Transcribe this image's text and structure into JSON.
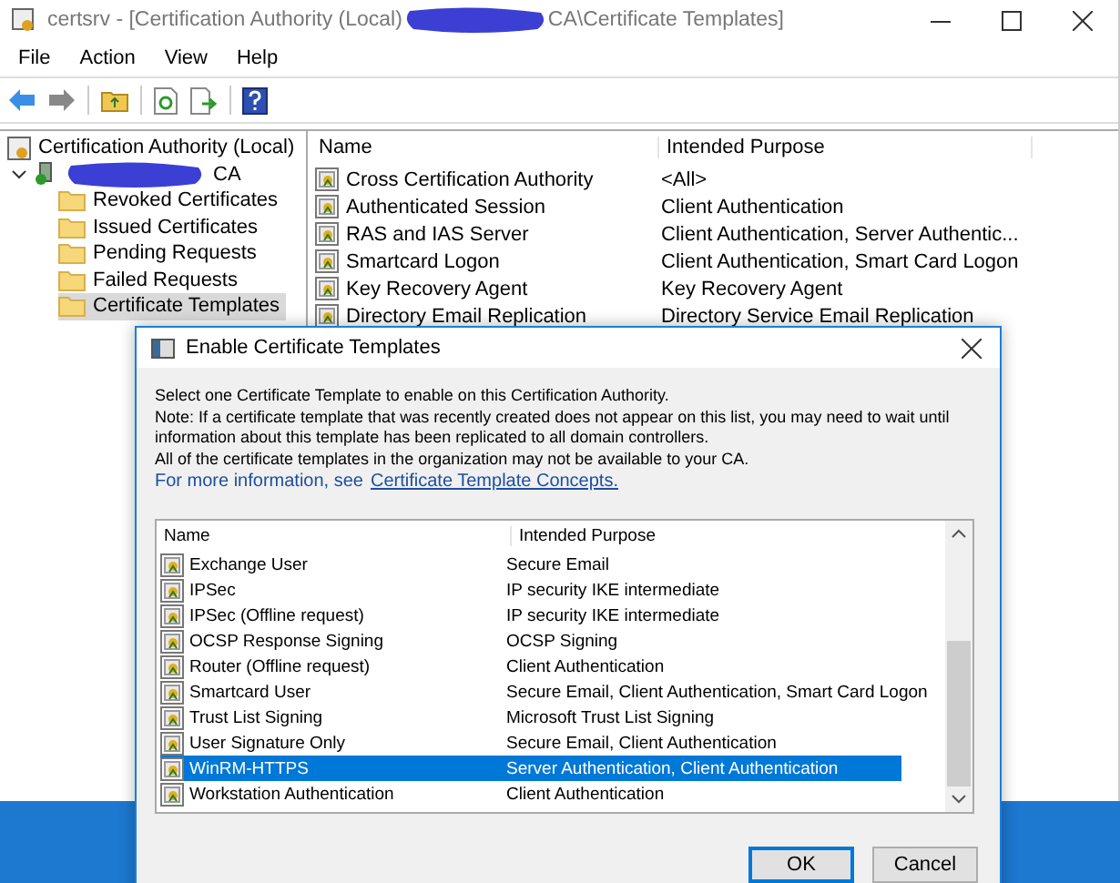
{
  "window": {
    "title_start": "certsrv - [Certification Authority (Local)",
    "title_end": "CA\\Certificate Templates]"
  },
  "menu": [
    "File",
    "Action",
    "View",
    "Help"
  ],
  "tree": {
    "label": "Certification Authority (Local)",
    "children": [
      {
        "label": "CA",
        "expanded": true,
        "children": [
          {
            "label": "Revoked Certificates",
            "selected": false
          },
          {
            "label": "Issued Certificates",
            "selected": false
          },
          {
            "label": "Pending Requests",
            "selected": false
          },
          {
            "label": "Failed Requests",
            "selected": false
          },
          {
            "label": "Certificate Templates",
            "selected": true
          }
        ]
      }
    ]
  },
  "list": {
    "columns": [
      "Name",
      "Intended Purpose"
    ],
    "rows": [
      {
        "name": "Cross Certification Authority",
        "purpose": "<All>"
      },
      {
        "name": "Authenticated Session",
        "purpose": "Client Authentication"
      },
      {
        "name": "RAS and IAS Server",
        "purpose": "Client Authentication, Server Authentic..."
      },
      {
        "name": "Smartcard Logon",
        "purpose": "Client Authentication, Smart Card Logon"
      },
      {
        "name": "Key Recovery Agent",
        "purpose": "Key Recovery Agent"
      },
      {
        "name": "Directory Email Replication",
        "purpose": "Directory Service Email Replication"
      }
    ]
  },
  "dialog": {
    "title": "Enable Certificate Templates",
    "lines": [
      "Select one Certificate Template to enable on this Certification Authority.",
      "Note: If a certificate template that was recently created does not appear on this list, you may need to wait until",
      "information about this template has been replicated to all domain controllers.",
      "All of the certificate templates in the organization may not be available to your CA."
    ],
    "link_prefix": "For more information, see",
    "link": "Certificate Template Concepts.",
    "list": {
      "columns": [
        "Name",
        "Intended Purpose"
      ],
      "rows": [
        {
          "name": "Exchange User",
          "purpose": "Secure Email",
          "selected": false
        },
        {
          "name": "IPSec",
          "purpose": "IP security IKE intermediate",
          "selected": false
        },
        {
          "name": "IPSec (Offline request)",
          "purpose": "IP security IKE intermediate",
          "selected": false
        },
        {
          "name": "OCSP Response Signing",
          "purpose": "OCSP Signing",
          "selected": false
        },
        {
          "name": "Router (Offline request)",
          "purpose": "Client Authentication",
          "selected": false
        },
        {
          "name": "Smartcard User",
          "purpose": "Secure Email, Client Authentication, Smart Card Logon",
          "selected": false
        },
        {
          "name": "Trust List Signing",
          "purpose": "Microsoft Trust List Signing",
          "selected": false
        },
        {
          "name": "User Signature Only",
          "purpose": "Secure Email, Client Authentication",
          "selected": false
        },
        {
          "name": "WinRM-HTTPS",
          "purpose": "Server Authentication, Client Authentication",
          "selected": true
        },
        {
          "name": "Workstation Authentication",
          "purpose": "Client Authentication",
          "selected": false
        }
      ]
    },
    "buttons": [
      {
        "label": "OK",
        "default": true
      },
      {
        "label": "Cancel",
        "default": false
      }
    ]
  }
}
